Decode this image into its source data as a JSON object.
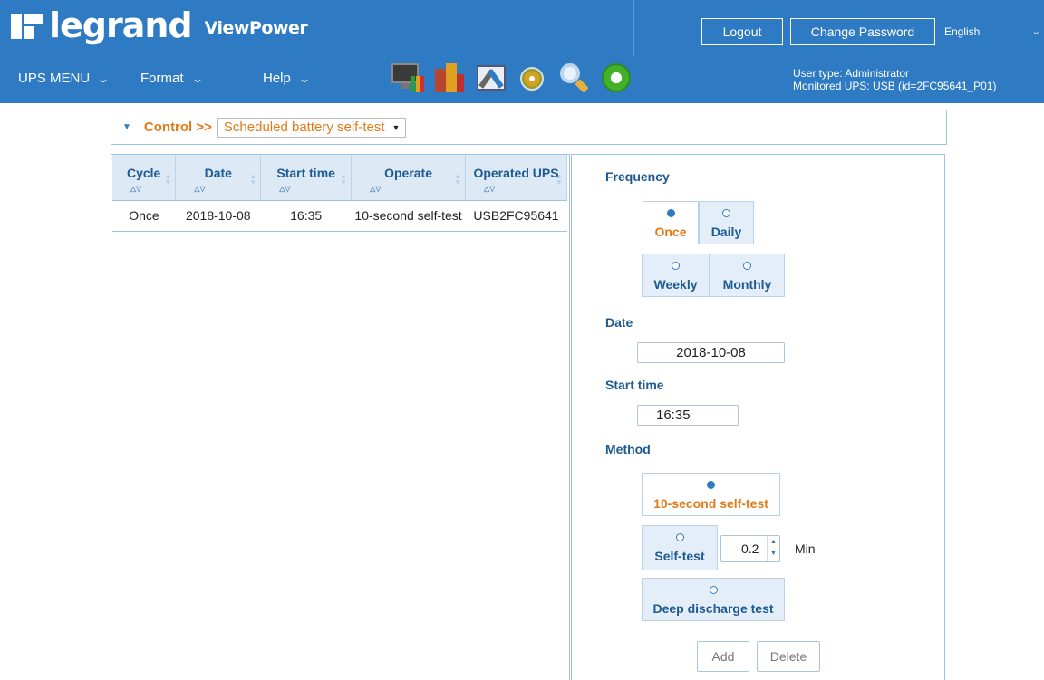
{
  "header": {
    "logo_text": "legrand",
    "app_title": "ViewPower",
    "logout_label": "Logout",
    "change_password_label": "Change Password",
    "language": "English",
    "menu": [
      {
        "label": "UPS MENU"
      },
      {
        "label": "Format"
      },
      {
        "label": "Help"
      }
    ],
    "toolbar_icons": [
      "monitor-chart-icon",
      "buildings-icon",
      "tools-icon",
      "disc-icon",
      "search-icon",
      "refresh-icon"
    ],
    "user_type": "User type: Administrator",
    "monitored_ups": "Monitored UPS: USB (id=2FC95641_P01)",
    "bg_color": "#2e7bc4"
  },
  "control": {
    "label": "Control >>",
    "selected_page": "Scheduled battery self-test"
  },
  "table": {
    "columns": [
      "Cycle",
      "Date",
      "Start time",
      "Operate",
      "Operated UPS"
    ],
    "rows": [
      [
        "Once",
        "2018-10-08",
        "16:35",
        "10-second self-test",
        "USB2FC95641"
      ]
    ]
  },
  "form": {
    "frequency_label": "Frequency",
    "frequency_options": [
      "Once",
      "Daily",
      "Weekly",
      "Monthly"
    ],
    "frequency_selected": "Once",
    "date_label": "Date",
    "date_value": "2018-10-08",
    "start_time_label": "Start time",
    "start_time_value": "16:35",
    "method_label": "Method",
    "method_options": [
      "10-second self-test",
      "Self-test",
      "Deep discharge test"
    ],
    "method_selected": "10-second self-test",
    "self_test_minutes": "0.2",
    "minutes_unit": "Min",
    "add_label": "Add",
    "delete_label": "Delete"
  },
  "colors": {
    "accent_orange": "#e07b1a",
    "label_blue": "#1e5a92",
    "header_blue": "#2e7bc4"
  }
}
